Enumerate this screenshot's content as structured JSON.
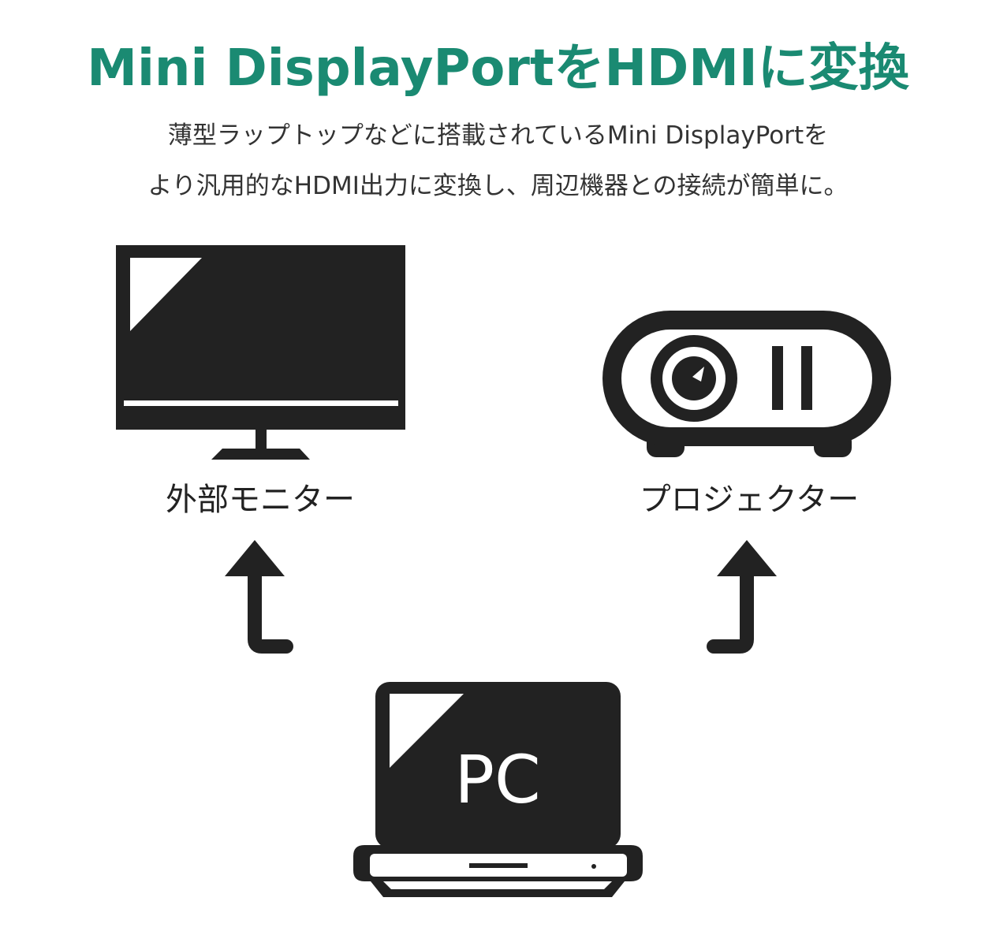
{
  "header": {
    "title": "Mini DisplayPortをHDMIに変換",
    "description_line1": "薄型ラップトップなどに搭載されているMini DisplayPortを",
    "description_line2": "より汎用的なHDMI出力に変換し、周辺機器との接続が簡単に。"
  },
  "devices": {
    "monitor_label": "外部モニター",
    "projector_label": "プロジェクター",
    "pc_label": "PC"
  },
  "colors": {
    "title": "#1a8a72",
    "icon": "#222222",
    "background": "#ffffff"
  },
  "icons": [
    "monitor-icon",
    "projector-icon",
    "laptop-icon",
    "arrow-up-icon",
    "arrow-up-icon"
  ]
}
